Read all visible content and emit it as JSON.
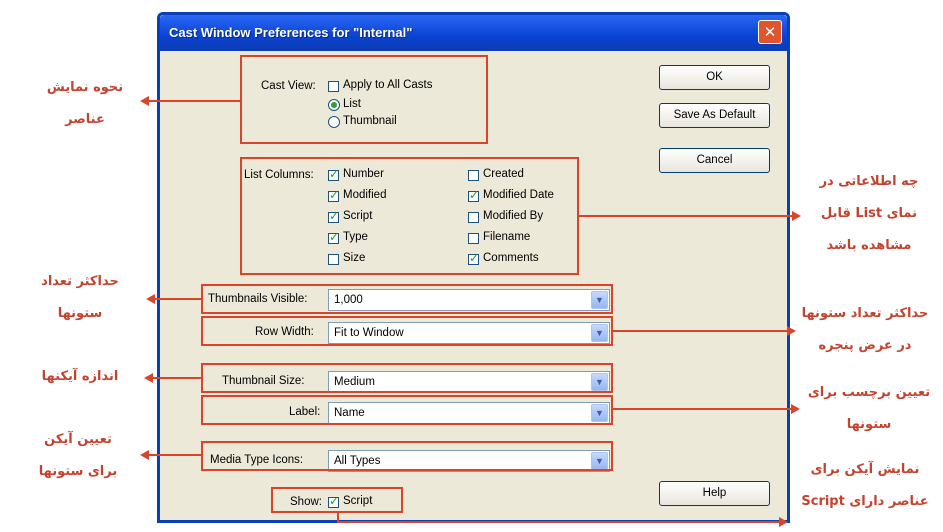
{
  "dialog": {
    "title": "Cast Window Preferences for \"Internal\"",
    "close_glyph": "✕"
  },
  "cast_view": {
    "label": "Cast View:",
    "apply_all": {
      "label": "Apply to All Casts",
      "checked": false
    },
    "list": {
      "label": "List",
      "selected": true
    },
    "thumbnail": {
      "label": "Thumbnail",
      "selected": false
    }
  },
  "list_columns": {
    "label": "List Columns:",
    "items": [
      {
        "label": "Number",
        "checked": true
      },
      {
        "label": "Modified",
        "checked": true
      },
      {
        "label": "Script",
        "checked": true
      },
      {
        "label": "Type",
        "checked": true
      },
      {
        "label": "Size",
        "checked": false
      },
      {
        "label": "Created",
        "checked": false
      },
      {
        "label": "Modified Date",
        "checked": true
      },
      {
        "label": "Modified By",
        "checked": false
      },
      {
        "label": "Filename",
        "checked": false
      },
      {
        "label": "Comments",
        "checked": true
      }
    ]
  },
  "fields": {
    "thumbnails_visible": {
      "label": "Thumbnails Visible:",
      "value": "1,000"
    },
    "row_width": {
      "label": "Row Width:",
      "value": "Fit to Window"
    },
    "thumbnail_size": {
      "label": "Thumbnail Size:",
      "value": "Medium"
    },
    "label_field": {
      "label": "Label:",
      "value": "Name"
    },
    "media_type_icons": {
      "label": "Media Type Icons:",
      "value": "All Types"
    }
  },
  "show": {
    "label": "Show:",
    "script": {
      "label": "Script",
      "checked": true
    }
  },
  "buttons": {
    "ok": "OK",
    "save_default": "Save As Default",
    "cancel": "Cancel",
    "help": "Help"
  },
  "annotations": {
    "cast_view_l1": "نحوه نمایش",
    "cast_view_l2": "عناصر",
    "list_info_l1": "چه اطلاعاتی در",
    "list_info_l2": "نمای List قابل",
    "list_info_l3": "مشاهده باشد",
    "max_count_l1": "حداکثر تعداد",
    "max_count_l2": "ستونها",
    "max_cols_l1": "حداکثر تعداد ستونها",
    "max_cols_l2": "در عرض پنجره",
    "icon_size": "اندازه آیکنها",
    "label_l1": "تعیین برچسب برای",
    "label_l2": "ستونها",
    "icon_type_l1": "تعیین آیکن",
    "icon_type_l2": "برای ستونها",
    "script_l1": "نمایش آیکن برای",
    "script_l2": "عناصر دارای Script"
  },
  "colors": {
    "annotation": "#d9452a",
    "titlebar": "#0a43d2",
    "dialog_bg": "#ece9d8"
  },
  "icons": {
    "select_arrow": "▼"
  }
}
